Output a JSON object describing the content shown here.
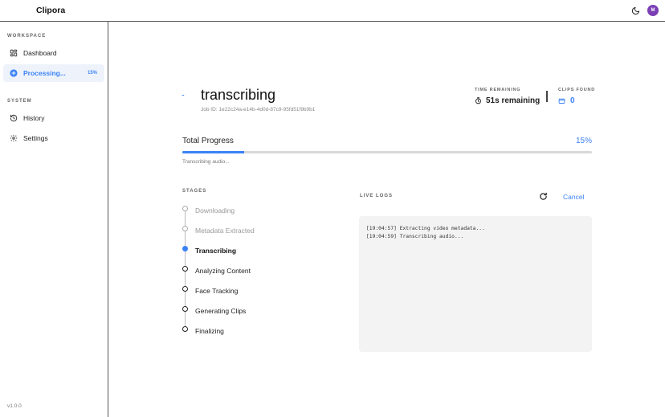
{
  "app": {
    "title": "Clipora",
    "avatar_initial": "M",
    "version": "v1.0.0"
  },
  "colors": {
    "accent": "#3b82f6",
    "avatar": "#7b3fb5"
  },
  "sidebar": {
    "workspace_label": "WORKSPACE",
    "system_label": "SYSTEM",
    "workspace_items": [
      {
        "label": "Dashboard",
        "icon": "dashboard-grid-icon"
      },
      {
        "label": "Processing...",
        "icon": "processing-icon",
        "badge": "15%",
        "active": true
      }
    ],
    "system_items": [
      {
        "label": "History",
        "icon": "history-clock-icon"
      },
      {
        "label": "Settings",
        "icon": "gear-icon"
      }
    ]
  },
  "job": {
    "title": "transcribing",
    "id_text": "Job ID: 1e22c24a-e14b-4d0d-87c9-95fd51f9b9b1"
  },
  "stats": {
    "time_label": "TIME REMAINING",
    "time_value": "51s remaining",
    "clips_label": "CLIPS FOUND",
    "clips_value": "0"
  },
  "progress": {
    "label": "Total Progress",
    "percent_text": "15%",
    "fraction": 0.15,
    "status": "Transcribing audio..."
  },
  "stages": {
    "label": "STAGES",
    "items": [
      {
        "name": "Downloading",
        "state": "done"
      },
      {
        "name": "Metadata Extracted",
        "state": "done"
      },
      {
        "name": "Transcribing",
        "state": "current"
      },
      {
        "name": "Analyzing Content",
        "state": "pending"
      },
      {
        "name": "Face Tracking",
        "state": "pending"
      },
      {
        "name": "Generating Clips",
        "state": "pending"
      },
      {
        "name": "Finalizing",
        "state": "pending"
      }
    ]
  },
  "logs": {
    "label": "LIVE LOGS",
    "cancel_label": "Cancel",
    "lines": [
      "[19:04:57] Extracting video metadata...",
      "[19:04:59] Transcribing audio..."
    ]
  }
}
